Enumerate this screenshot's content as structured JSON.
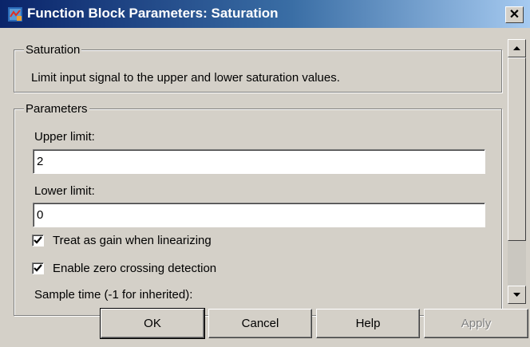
{
  "window": {
    "title": "Function Block Parameters: Saturation",
    "close_glyph": "✕"
  },
  "description_group": {
    "legend": "Saturation",
    "text": "Limit input signal to the upper and lower saturation values."
  },
  "parameters_group": {
    "legend": "Parameters",
    "upper_limit": {
      "label": "Upper limit:",
      "value": "2"
    },
    "lower_limit": {
      "label": "Lower limit:",
      "value": "0"
    },
    "treat_as_gain": {
      "label": "Treat as gain when linearizing",
      "checked": true
    },
    "zero_crossing": {
      "label": "Enable zero crossing detection",
      "checked": true
    },
    "sample_time": {
      "label": "Sample time (-1 for inherited):"
    }
  },
  "buttons": {
    "ok": "OK",
    "cancel": "Cancel",
    "help": "Help",
    "apply": "Apply"
  },
  "icons": {
    "app": "simulink-block-icon",
    "close": "close-icon",
    "scroll_up": "arrow-up-icon",
    "scroll_down": "arrow-down-icon",
    "check": "checkmark-icon"
  },
  "colors": {
    "titlebar_start": "#0a246a",
    "titlebar_end": "#a6caf0",
    "face": "#d4d0c8"
  }
}
